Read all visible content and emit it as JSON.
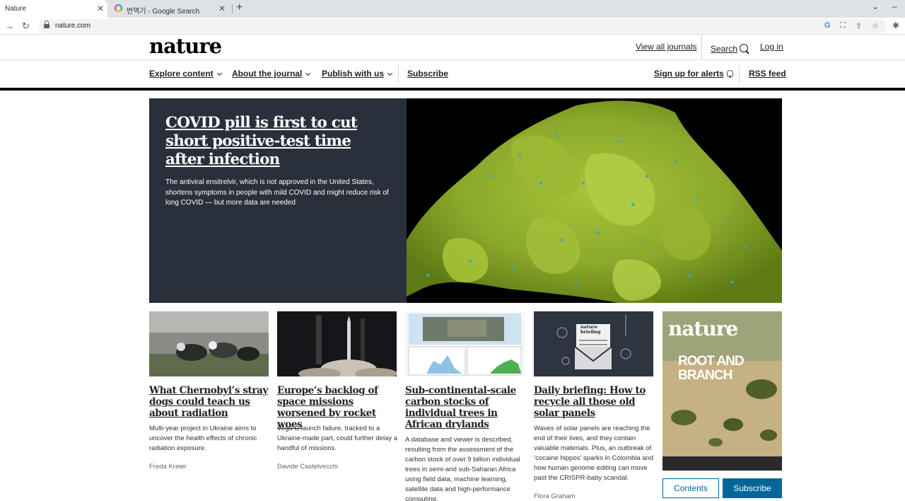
{
  "browser": {
    "tabs": [
      {
        "title": "Nature",
        "active": true
      },
      {
        "title": "번역기 - Google Search",
        "active": false
      }
    ],
    "new_tab": "+",
    "url": "nature.com"
  },
  "site": {
    "logo": "nature",
    "top_links": {
      "journals": "View all journals",
      "search": "Search",
      "login": "Log in"
    },
    "nav": {
      "explore": "Explore content",
      "about": "About the journal",
      "publish": "Publish with us",
      "subscribe": "Subscribe",
      "alerts": "Sign up for alerts",
      "rss": "RSS feed"
    }
  },
  "hero": {
    "title": "COVID pill is first to cut short positive-test time after infection",
    "summary": "The antiviral ensitrelvir, which is not approved in the United States, shortens symptoms in people with mild COVID and might reduce risk of long COVID — but more data are needed"
  },
  "cards": [
    {
      "title": "What Chernobyl’s stray dogs could teach us about radiation",
      "summary": "Multi-year project in Ukraine aims to uncover the health effects of chronic radiation exposure.",
      "author": "Freda Kreier"
    },
    {
      "title": "Europe’s backlog of space missions worsened by rocket woes",
      "summary": "Vega C launch failure, tracked to a Ukraine-made part, could further delay a handful of missions.",
      "author": "Davide Castelvecchi"
    },
    {
      "title": "Sub-continental-scale carbon stocks of individual trees in African drylands",
      "summary": "A database and viewer is described, resulting from the assessment of the carbon stock of over 9 billion individual trees in semi-arid sub-Saharan Africa using field data, machine learning, satellite data and high-performance computing.",
      "author": ""
    },
    {
      "title": "Daily briefing: How to recycle all those old solar panels",
      "summary": "Waves of solar panels are reaching the end of their lives, and they contain valuable materials. Plus, an outbreak of ‘cocaine hippos’ sparks in Colombia and how human genome editing can move past the CRISPR-baby scandal.",
      "author": "Flora Graham"
    }
  ],
  "briefing_badge": "nature briefing",
  "cover": {
    "logo": "nature",
    "headline_1": "ROOT AND",
    "headline_2": "BRANCH"
  },
  "buttons": {
    "contents": "Contents",
    "subscribe": "Subscribe"
  },
  "colors": {
    "accent": "#006699",
    "hero_bg": "#29303b"
  }
}
